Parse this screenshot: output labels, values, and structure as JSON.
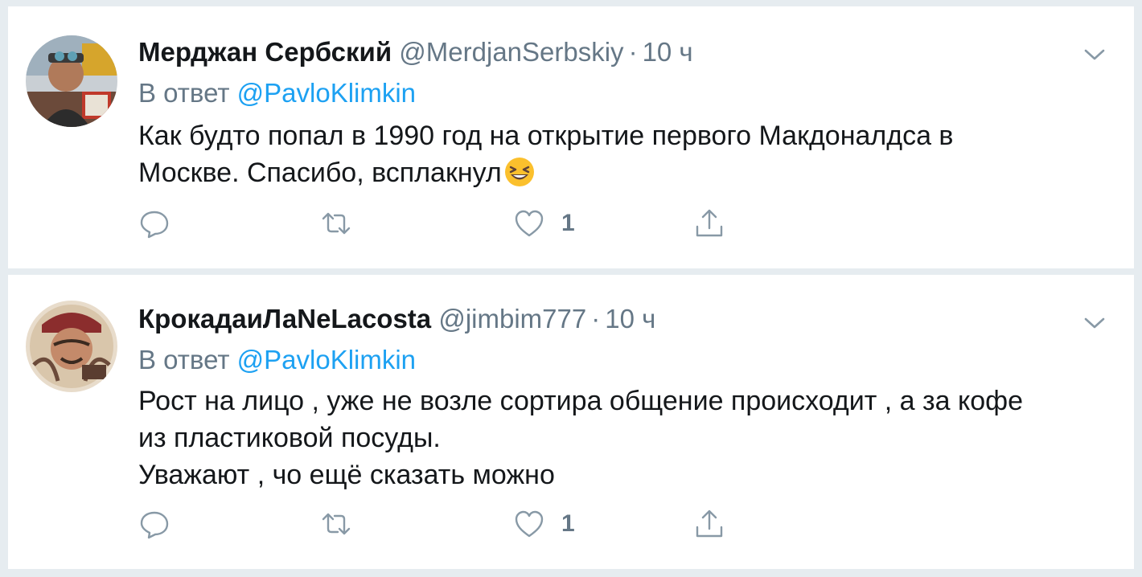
{
  "tweets": [
    {
      "name": "Мерджан Сербский",
      "handle": "@MerdjanSerbskiy",
      "separator": "·",
      "time": "10 ч",
      "reply_prefix": "В ответ",
      "reply_mention": "@PavloKlimkin",
      "text_lines": [
        "Как будто попал в 1990 год на открытие первого Макдоналдса в",
        "Москве. Спасибо, всплакнул"
      ],
      "emoji": "laughing-emoji",
      "like_count": "1"
    },
    {
      "name": "КрокадаиЛаNeLacosta",
      "handle": "@jimbim777",
      "separator": "·",
      "time": "10 ч",
      "reply_prefix": "В ответ",
      "reply_mention": "@PavloKlimkin",
      "text_lines": [
        "Рост на лицо , уже не возле сортира общение происходит , а за кофе",
        "из пластиковой посуды.",
        "Уважают , чо ещё сказать можно"
      ],
      "like_count": "1"
    }
  ],
  "colors": {
    "background": "#e6ecf0",
    "card": "#ffffff",
    "text": "#14171a",
    "secondary": "#657786",
    "link": "#1da1f2"
  },
  "icons": [
    "reply-icon",
    "retweet-icon",
    "like-icon",
    "share-icon",
    "chevron-down-icon"
  ]
}
